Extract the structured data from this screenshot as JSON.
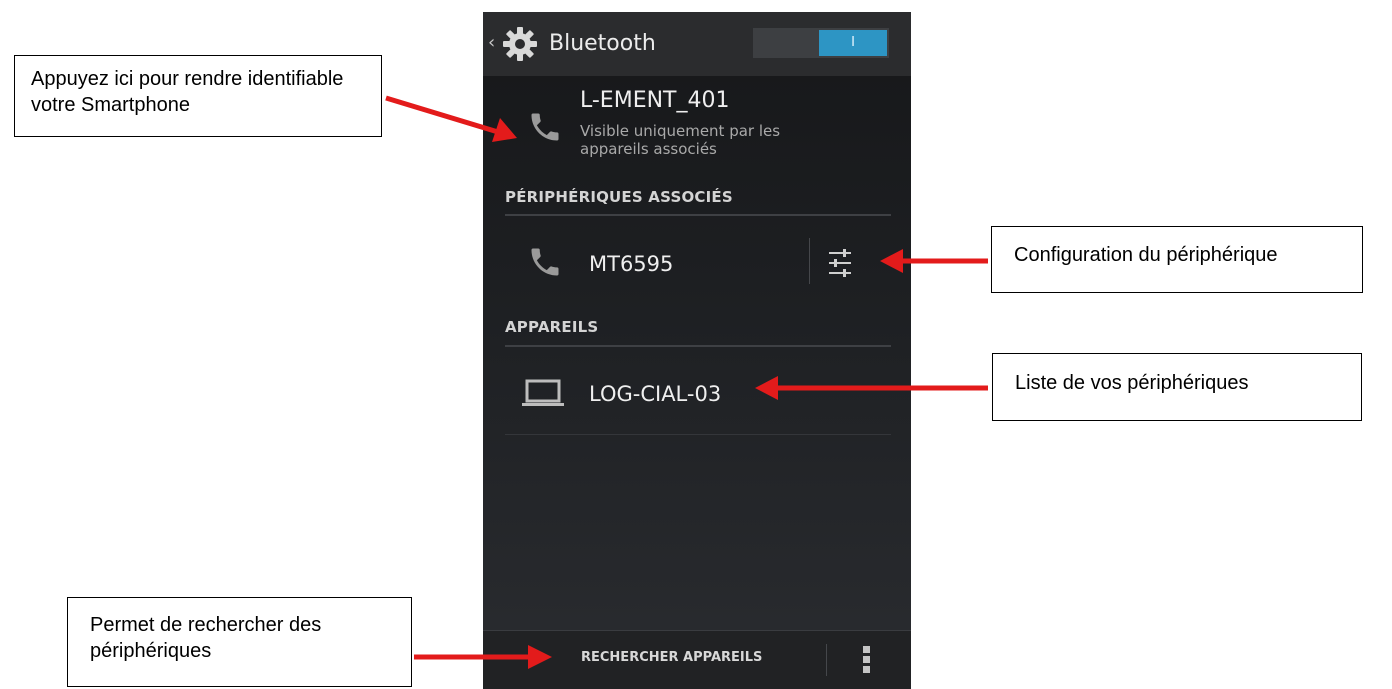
{
  "action_bar": {
    "back_glyph": "‹",
    "title": "Bluetooth",
    "toggle_label": "I",
    "toggle_color": "#2d95c4"
  },
  "this_device": {
    "icon": "phone-icon",
    "name": "L-EMENT_401",
    "visibility": "Visible uniquement par les appareils associés"
  },
  "paired_section": {
    "header": "PÉRIPHÉRIQUES ASSOCIÉS",
    "items": [
      {
        "icon": "phone-icon",
        "name": "MT6595",
        "action_icon": "settings-sliders-icon"
      }
    ]
  },
  "available_section": {
    "header": "APPAREILS",
    "items": [
      {
        "icon": "laptop-icon",
        "name": "LOG-CIAL-03"
      }
    ]
  },
  "bottom_bar": {
    "scan_label": "RECHERCHER APPAREILS",
    "overflow_icon": "overflow-menu-icon"
  },
  "callouts": {
    "identify": "Appuyez ici pour rendre identifiable votre Smartphone",
    "configure": "Configuration du périphérique",
    "list": "Liste de vos périphériques",
    "scan": "Permet de rechercher des périphériques",
    "arrow_color": "#e31b1b"
  }
}
